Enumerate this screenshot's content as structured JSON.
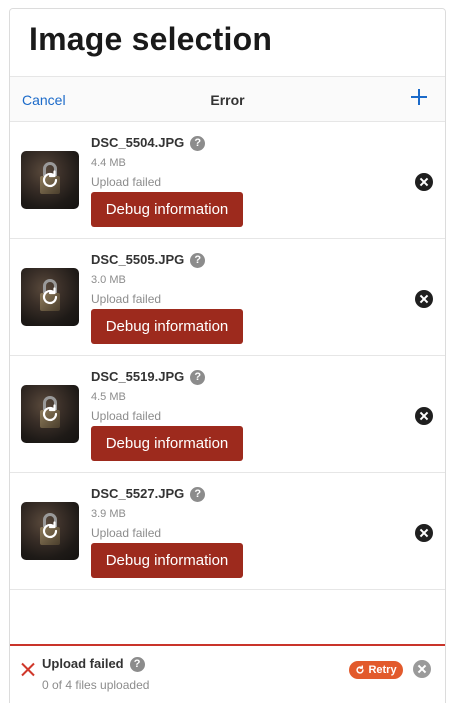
{
  "header": {
    "title": "Image selection"
  },
  "topbar": {
    "cancel_label": "Cancel",
    "title": "Error",
    "add_icon": "plus-icon"
  },
  "files": [
    {
      "name": "DSC_5504.JPG",
      "size": "4.4 MB",
      "status": "Upload failed",
      "debug_label": "Debug information",
      "help": "?"
    },
    {
      "name": "DSC_5505.JPG",
      "size": "3.0 MB",
      "status": "Upload failed",
      "debug_label": "Debug information",
      "help": "?"
    },
    {
      "name": "DSC_5519.JPG",
      "size": "4.5 MB",
      "status": "Upload failed",
      "debug_label": "Debug information",
      "help": "?"
    },
    {
      "name": "DSC_5527.JPG",
      "size": "3.9 MB",
      "status": "Upload failed",
      "debug_label": "Debug information",
      "help": "?"
    }
  ],
  "statusbar": {
    "title": "Upload failed",
    "help": "?",
    "subtitle": "0 of 4 files uploaded",
    "retry_label": "Retry"
  },
  "colors": {
    "accent": "#1b6ac9",
    "error": "#9d2a1d",
    "retry": "#e25a2c",
    "status_border": "#c9342a"
  }
}
